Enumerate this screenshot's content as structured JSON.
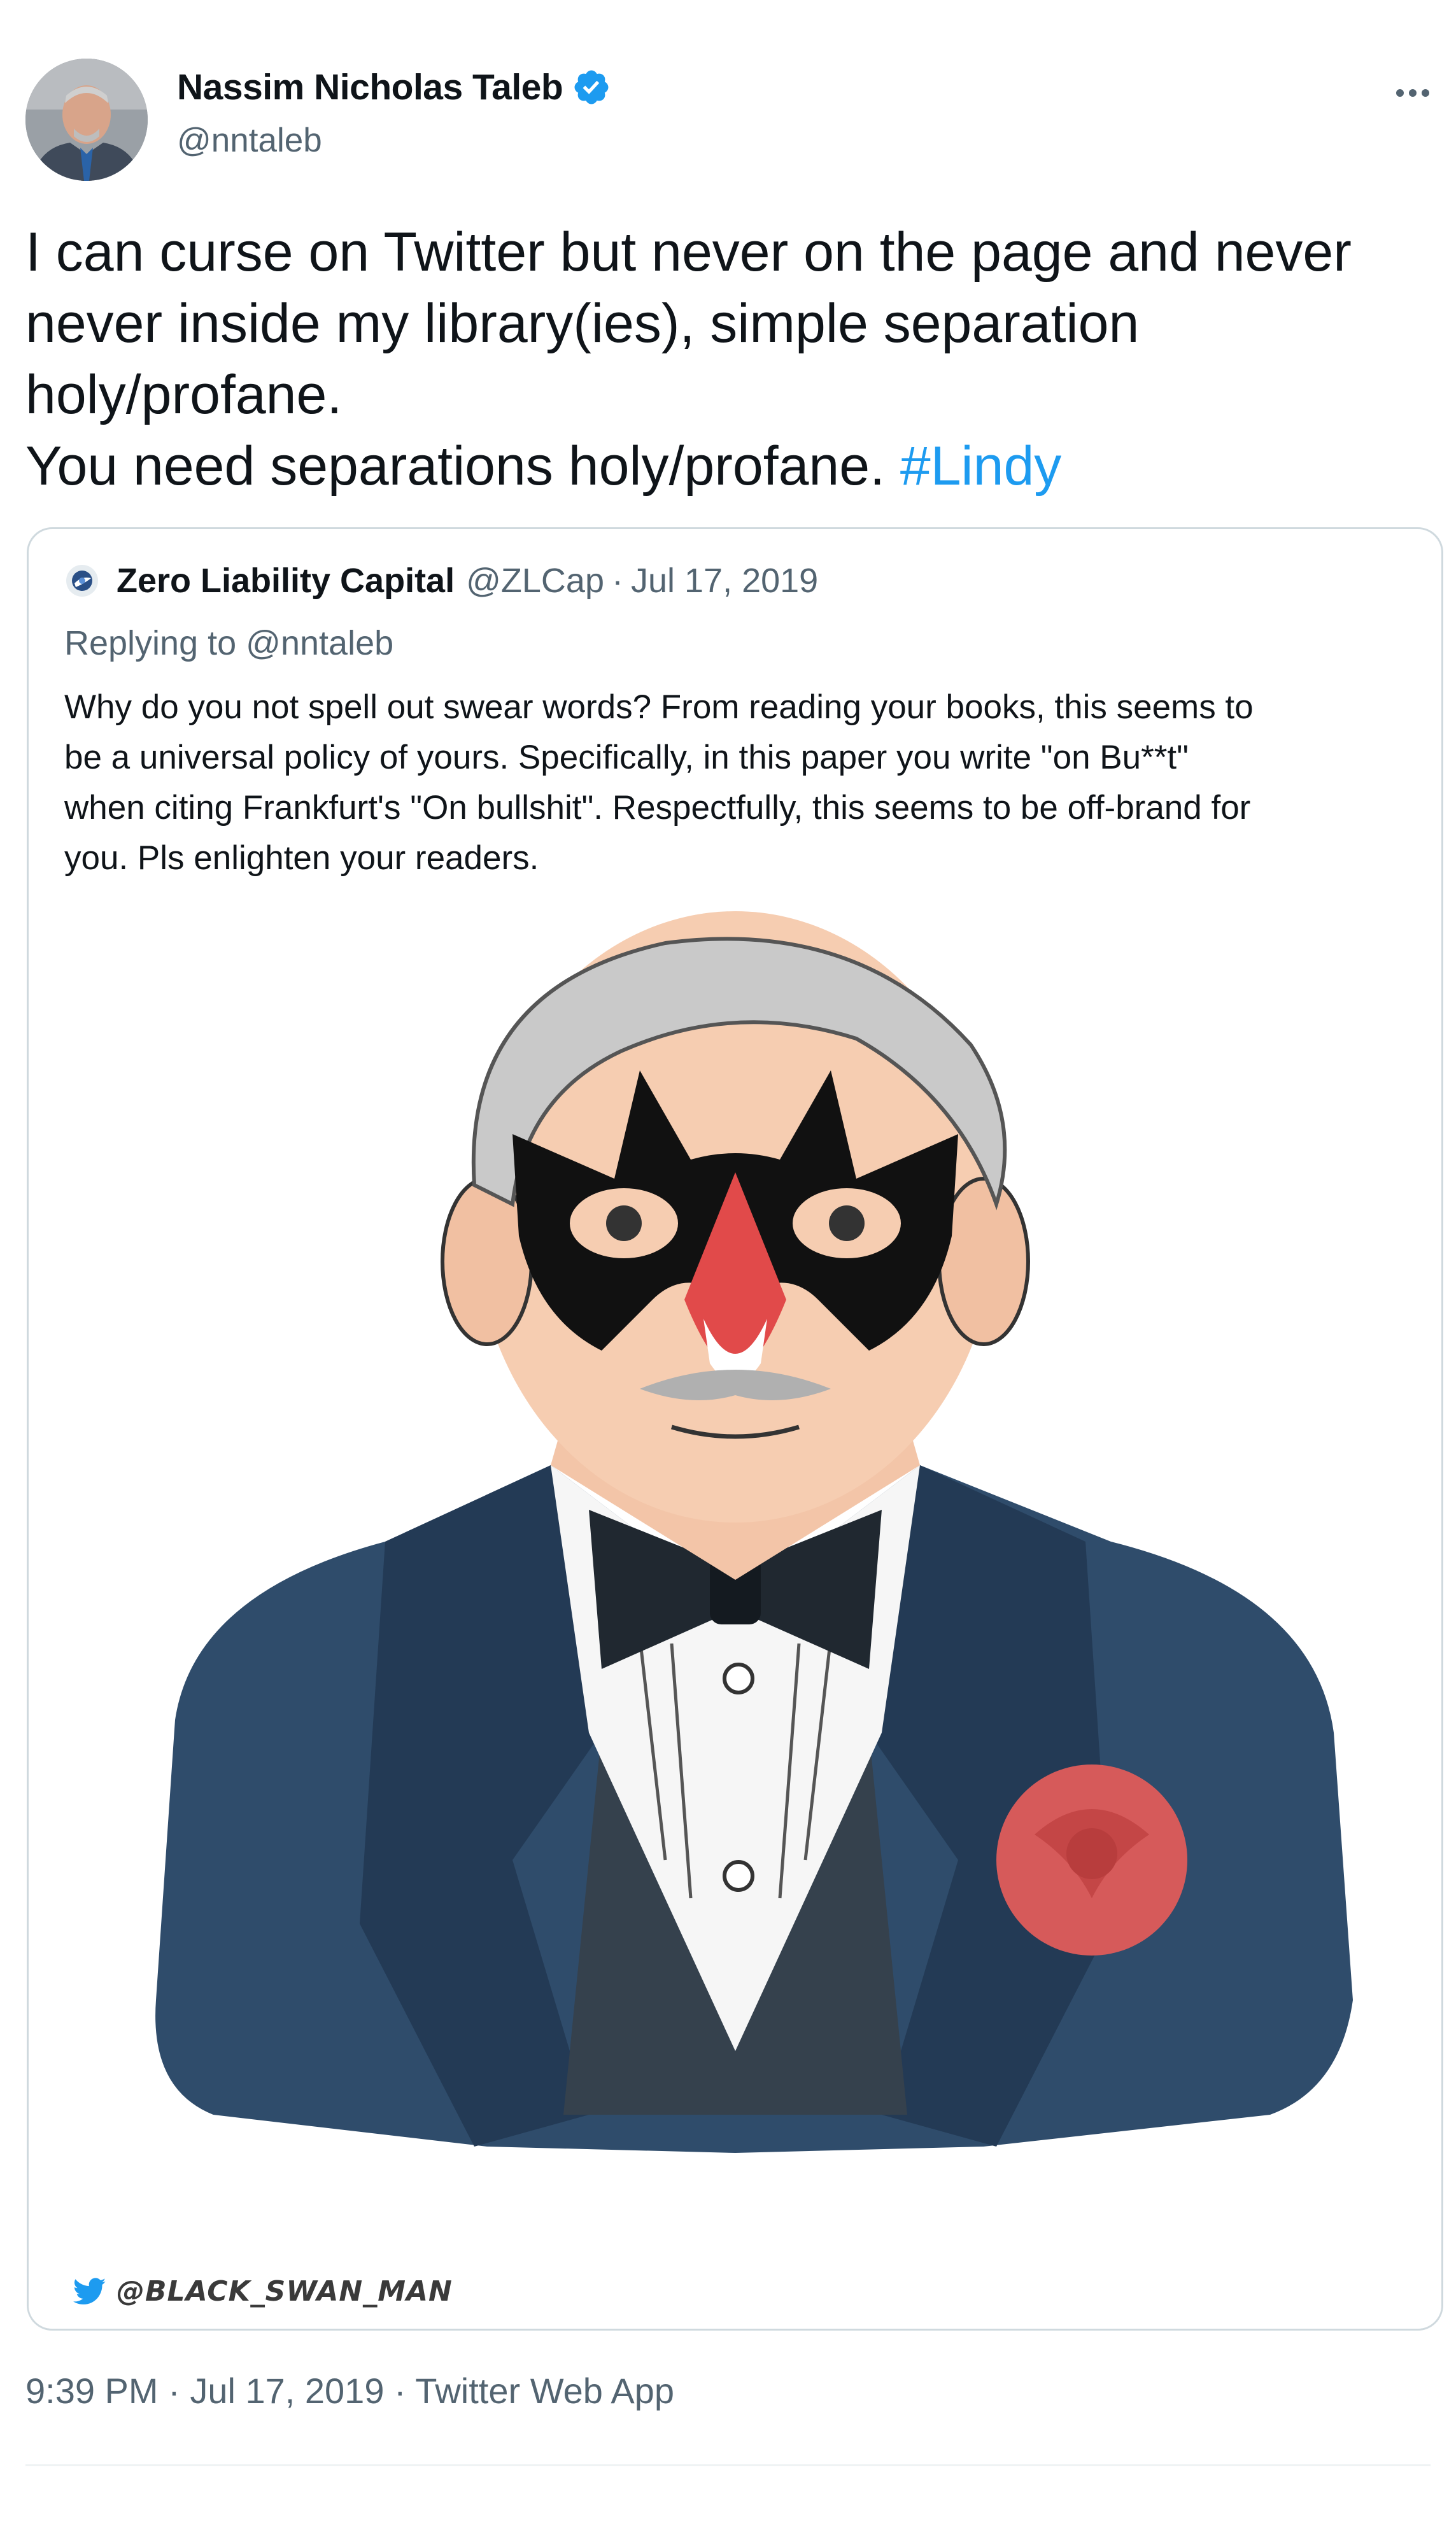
{
  "author": {
    "name": "Nassim Nicholas Taleb",
    "handle": "@nntaleb",
    "verified_icon": "verified-badge-icon",
    "avatar": "author-avatar"
  },
  "more_icon": "more-options-icon",
  "tweet": {
    "lines": [
      "I can curse on Twitter but never on the page and never",
      "never inside my library(ies), simple separation",
      "holy/profane.",
      "You need separations holy/profane."
    ],
    "hashtag": "#Lindy"
  },
  "quoted_tweet": {
    "author_name": "Zero Liability Capital",
    "handle": "@ZLCap",
    "separator": "·",
    "date": "Jul 17, 2019",
    "replying_to": "Replying to @nntaleb",
    "lines": [
      "Why do you not spell out swear words? From reading your books, this seems to",
      "be a universal policy of yours. Specifically, in this paper you write \"on Bu**t\"",
      "when citing Frankfurt's \"On bullshit\". Respectfully, this seems to be off-brand for",
      "you. Pls enlighten your readers."
    ],
    "image": {
      "description_icon": "masked-man-illustration",
      "watermark": "@BLACK_SWAN_MAN"
    }
  },
  "meta": {
    "time": "9:39 PM",
    "separator": "·",
    "date": "Jul 17, 2019",
    "source": "Twitter Web App"
  },
  "colors": {
    "link": "#1d9bf0",
    "secondary_text": "#536471",
    "border": "#cfd9de"
  }
}
